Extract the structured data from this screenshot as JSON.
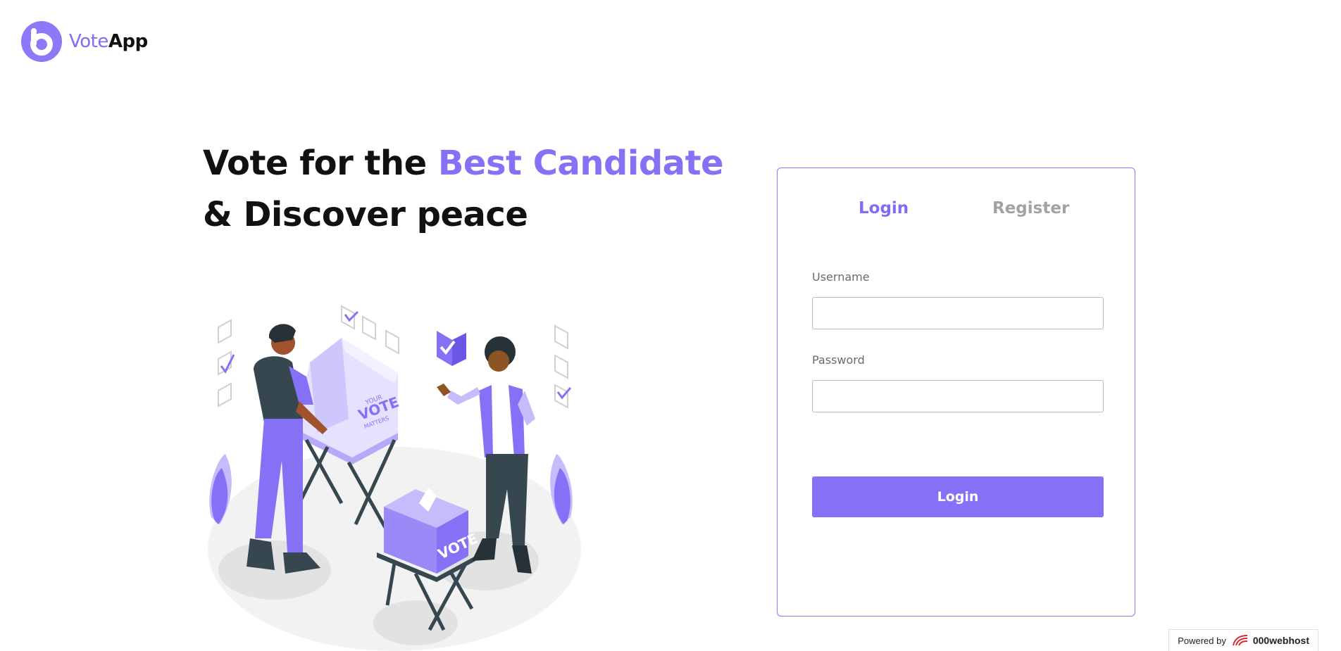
{
  "header": {
    "logo_part1": "Vote",
    "logo_part2": "App"
  },
  "hero": {
    "line1_prefix": "Vote for the ",
    "line1_accent": "Best Candidate",
    "line2": "& Discover peace"
  },
  "illustration": {
    "booth_text_small": "YOUR",
    "booth_text_big": "VOTE",
    "booth_text_small2": "MATTERS",
    "ballot_box_text": "VOTE"
  },
  "auth": {
    "tab_login": "Login",
    "tab_register": "Register",
    "username_label": "Username",
    "username_value": "",
    "password_label": "Password",
    "password_value": "",
    "submit_label": "Login"
  },
  "footer": {
    "powered_by": "Powered by",
    "brand": "000webhost"
  },
  "colors": {
    "accent": "#8471f6",
    "inactive_tab": "#a2a2a2",
    "dark": "#37474f"
  },
  "icons": {
    "logo": "voteapp-logo-icon",
    "host": "000webhost-icon"
  }
}
